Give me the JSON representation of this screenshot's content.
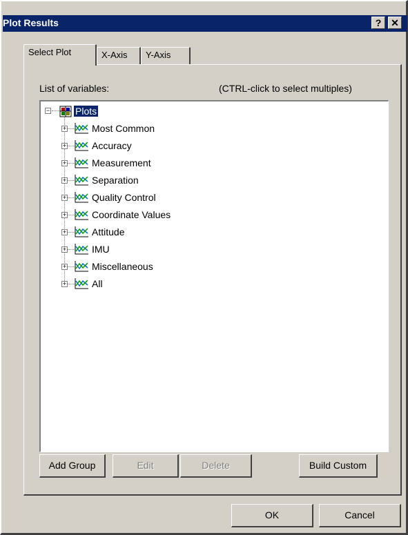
{
  "window": {
    "title": "Plot Results",
    "help_label": "?",
    "close_label": "✕"
  },
  "tabs": [
    {
      "label": "Select Plot",
      "active": true
    },
    {
      "label": "X-Axis",
      "active": false
    },
    {
      "label": "Y-Axis",
      "active": false
    }
  ],
  "panel": {
    "list_label": "List of variables:",
    "hint": "(CTRL-click to select multiples)"
  },
  "tree": {
    "root": {
      "label": "Plots",
      "expander": "−"
    },
    "items": [
      {
        "label": "Most Common",
        "expander": "+"
      },
      {
        "label": "Accuracy",
        "expander": "+"
      },
      {
        "label": "Measurement",
        "expander": "+"
      },
      {
        "label": "Separation",
        "expander": "+"
      },
      {
        "label": "Quality Control",
        "expander": "+"
      },
      {
        "label": "Coordinate Values",
        "expander": "+"
      },
      {
        "label": "Attitude",
        "expander": "+"
      },
      {
        "label": "IMU",
        "expander": "+"
      },
      {
        "label": "Miscellaneous",
        "expander": "+"
      },
      {
        "label": "All",
        "expander": "+"
      }
    ]
  },
  "buttons": {
    "add_group": "Add Group",
    "edit": "Edit",
    "delete": "Delete",
    "build_custom": "Build Custom",
    "ok": "OK",
    "cancel": "Cancel"
  },
  "colors": {
    "titlebar": "#0a246a",
    "face": "#d4d0c8",
    "selection": "#0a246a"
  }
}
